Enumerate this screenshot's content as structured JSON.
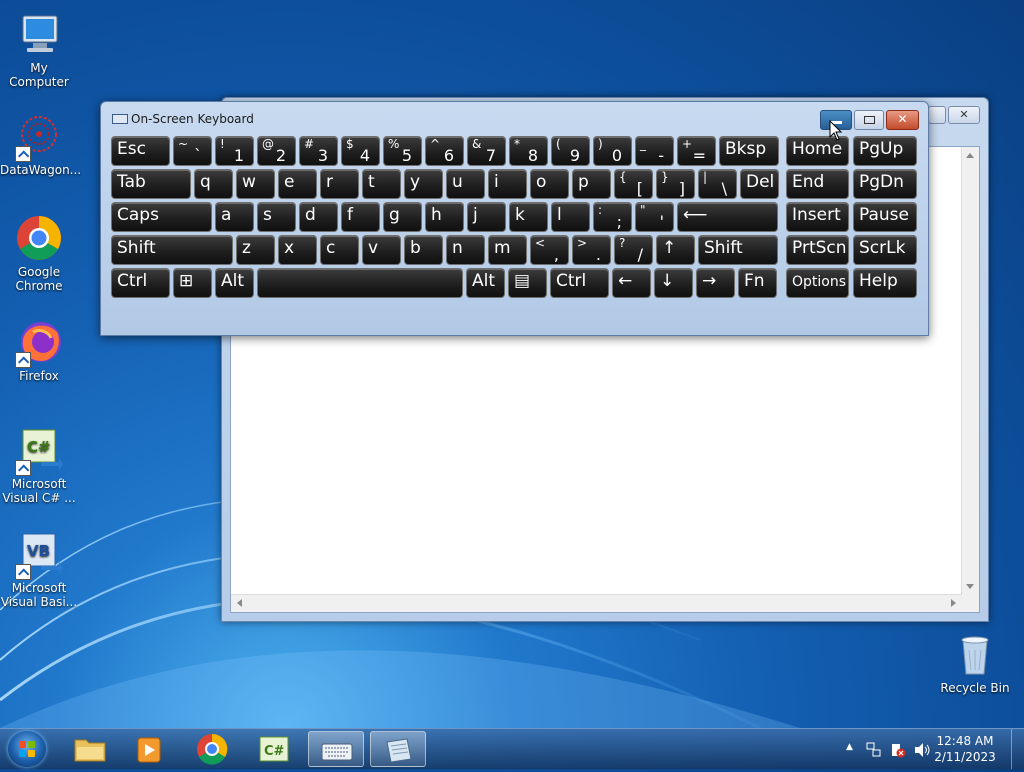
{
  "desktop": {
    "icons": [
      {
        "label": "My Computer"
      },
      {
        "label": "DataWagon..."
      },
      {
        "label": "Google\nChrome"
      },
      {
        "label": "Firefox"
      },
      {
        "label": "Microsoft\nVisual C# ..."
      },
      {
        "label": "Microsoft\nVisual Basi..."
      },
      {
        "label": "Recycle Bin"
      }
    ]
  },
  "osk": {
    "title": "On-Screen Keyboard",
    "close_glyph": "✕",
    "rows": [
      [
        {
          "l": "Esc"
        },
        {
          "t": "~",
          "b": "`"
        },
        {
          "t": "!",
          "b": "1"
        },
        {
          "t": "@",
          "b": "2"
        },
        {
          "t": "#",
          "b": "3"
        },
        {
          "t": "$",
          "b": "4"
        },
        {
          "t": "%",
          "b": "5"
        },
        {
          "t": "^",
          "b": "6"
        },
        {
          "t": "&",
          "b": "7"
        },
        {
          "t": "*",
          "b": "8"
        },
        {
          "t": "(",
          "b": "9"
        },
        {
          "t": ")",
          "b": "0"
        },
        {
          "t": "_",
          "b": "-"
        },
        {
          "t": "+",
          "b": "="
        },
        {
          "l": "Bksp"
        },
        {
          "l": "Home"
        },
        {
          "l": "PgUp"
        }
      ],
      [
        {
          "l": "Tab"
        },
        {
          "l": "q"
        },
        {
          "l": "w"
        },
        {
          "l": "e"
        },
        {
          "l": "r"
        },
        {
          "l": "t"
        },
        {
          "l": "y"
        },
        {
          "l": "u"
        },
        {
          "l": "i"
        },
        {
          "l": "o"
        },
        {
          "l": "p"
        },
        {
          "t": "{",
          "b": "["
        },
        {
          "t": "}",
          "b": "]"
        },
        {
          "t": "|",
          "b": "\\"
        },
        {
          "l": "Del"
        },
        {
          "l": "End"
        },
        {
          "l": "PgDn"
        }
      ],
      [
        {
          "l": "Caps"
        },
        {
          "l": "a"
        },
        {
          "l": "s"
        },
        {
          "l": "d"
        },
        {
          "l": "f"
        },
        {
          "l": "g"
        },
        {
          "l": "h"
        },
        {
          "l": "j"
        },
        {
          "l": "k"
        },
        {
          "l": "l"
        },
        {
          "t": ":",
          "b": ";"
        },
        {
          "t": "\"",
          "b": "'"
        },
        {
          "l": "⟵"
        },
        {
          "l": "Insert"
        },
        {
          "l": "Pause"
        }
      ],
      [
        {
          "l": "Shift"
        },
        {
          "l": "z"
        },
        {
          "l": "x"
        },
        {
          "l": "c"
        },
        {
          "l": "v"
        },
        {
          "l": "b"
        },
        {
          "l": "n"
        },
        {
          "l": "m"
        },
        {
          "t": "<",
          "b": ","
        },
        {
          "t": ">",
          "b": "."
        },
        {
          "t": "?",
          "b": "/"
        },
        {
          "l": "↑"
        },
        {
          "l": "Shift"
        },
        {
          "l": "PrtScn"
        },
        {
          "l": "ScrLk"
        }
      ],
      [
        {
          "l": "Ctrl"
        },
        {
          "l": "⊞"
        },
        {
          "l": "Alt"
        },
        {
          "l": ""
        },
        {
          "l": "Alt"
        },
        {
          "l": "▤"
        },
        {
          "l": "Ctrl"
        },
        {
          "l": "←"
        },
        {
          "l": "↓"
        },
        {
          "l": "→"
        },
        {
          "l": "Fn"
        },
        {
          "l": "Options"
        },
        {
          "l": "Help"
        }
      ]
    ]
  },
  "taskbar": {
    "time": "12:48 AM",
    "date": "2/11/2023",
    "apps": [
      "windows-explorer",
      "media-player",
      "google-chrome",
      "visual-csharp",
      "on-screen-keyboard",
      "notepad-window"
    ]
  },
  "colors": {
    "desktop": "#1460b3",
    "key": "#1d1d1d",
    "osk_frame": "#b2c9e6",
    "close": "#c44b2c"
  }
}
